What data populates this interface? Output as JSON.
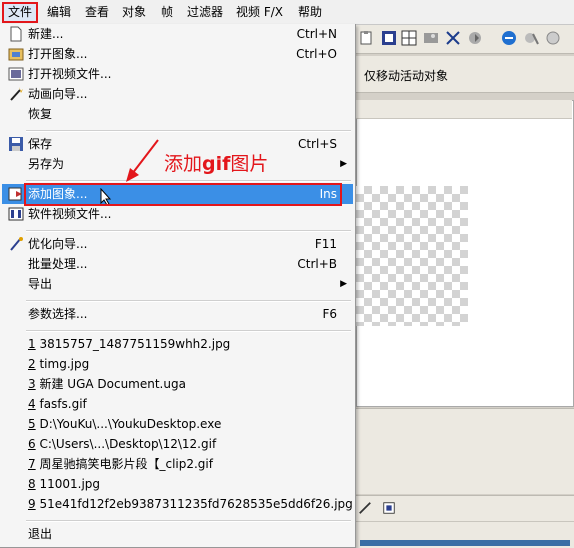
{
  "menubar": {
    "items": [
      "文件",
      "编辑",
      "查看",
      "对象",
      "帧",
      "过滤器",
      "视频 F/X",
      "帮助"
    ]
  },
  "file_menu": {
    "items": [
      {
        "label": "新建...",
        "shortcut": "Ctrl+N",
        "icon": "new-file-icon"
      },
      {
        "label": "打开图象...",
        "shortcut": "Ctrl+O",
        "icon": "open-image-icon"
      },
      {
        "label": "打开视频文件...",
        "shortcut": "",
        "icon": "open-video-icon"
      },
      {
        "label": "动画向导...",
        "shortcut": "",
        "icon": "wizard-icon"
      },
      {
        "label": "恢复",
        "shortcut": "",
        "icon": ""
      },
      {
        "label": "保存",
        "shortcut": "Ctrl+S",
        "icon": "save-icon"
      },
      {
        "label": "另存为",
        "shortcut": "",
        "icon": "",
        "submenu": true
      },
      {
        "label": "添加图象...",
        "shortcut": "Ins",
        "icon": "add-image-icon",
        "highlighted": true
      },
      {
        "label": "软件视频文件...",
        "shortcut": "",
        "icon": "video-file-icon"
      },
      {
        "label": "优化向导...",
        "shortcut": "F11",
        "icon": "optimize-wizard-icon"
      },
      {
        "label": "批量处理...",
        "shortcut": "Ctrl+B",
        "icon": ""
      },
      {
        "label": "导出",
        "shortcut": "",
        "icon": "",
        "submenu": true
      },
      {
        "label": "参数选择...",
        "shortcut": "F6",
        "icon": ""
      }
    ],
    "recent_files": [
      {
        "num": "1",
        "name": "3815757_1487751159whh2.jpg"
      },
      {
        "num": "2",
        "name": "timg.jpg"
      },
      {
        "num": "3",
        "name": "新建 UGA Document.uga"
      },
      {
        "num": "4",
        "name": "fasfs.gif"
      },
      {
        "num": "5",
        "name": "D:\\YouKu\\...\\YoukuDesktop.exe"
      },
      {
        "num": "6",
        "name": "C:\\Users\\...\\Desktop\\12\\12.gif"
      },
      {
        "num": "7",
        "name": "周星驰搞笑电影片段【_clip2.gif"
      },
      {
        "num": "8",
        "name": "11001.jpg"
      },
      {
        "num": "9",
        "name": "51e41fd12f2eb9387311235fd7628535e5dd6f26.jpg"
      }
    ],
    "exit_label": "退出"
  },
  "annotation": {
    "prefix": "添加",
    "bold": "gif",
    "suffix": "图片",
    "color": "#e3161b"
  },
  "app": {
    "toolbar2_label": "仅移动活动对象",
    "highlight_color": "#3b8fe6"
  }
}
